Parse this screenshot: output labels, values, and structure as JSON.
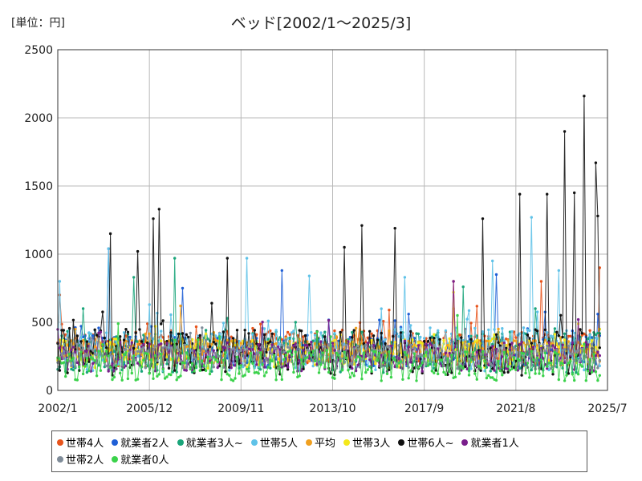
{
  "unit_label": "[単位：円]",
  "chart_data": {
    "type": "line",
    "title": "ベッド[2002/1～2025/3]",
    "xlabel": "",
    "ylabel": "",
    "ylim": [
      0,
      2500
    ],
    "yticks": [
      "0",
      "500",
      "1000",
      "1500",
      "2000",
      "2500"
    ],
    "xlim": [
      "2002/1",
      "2025/7"
    ],
    "xticks": [
      "2002/1",
      "2005/12",
      "2009/11",
      "2013/10",
      "2017/9",
      "2021/8",
      "2025/7"
    ],
    "grid": true,
    "legend_position": "bottom",
    "series": [
      {
        "name": "世帯4人",
        "color": "#e8541c",
        "baseline": 310,
        "amp": 130,
        "peaks": [
          [
            "2002/2",
            700
          ],
          [
            "2016/3",
            590
          ],
          [
            "2018/12",
            800
          ],
          [
            "2022/9",
            800
          ],
          [
            "2025/3",
            900
          ]
        ]
      },
      {
        "name": "就業者2人",
        "color": "#1f5fd6",
        "baseline": 290,
        "amp": 120,
        "peaks": [
          [
            "2004/3",
            1040
          ],
          [
            "2007/5",
            750
          ],
          [
            "2011/8",
            880
          ],
          [
            "2017/1",
            560
          ],
          [
            "2020/10",
            850
          ],
          [
            "2025/2",
            560
          ]
        ]
      },
      {
        "name": "就業者3人~",
        "color": "#1aa57a",
        "baseline": 280,
        "amp": 150,
        "peaks": [
          [
            "2003/2",
            600
          ],
          [
            "2005/4",
            830
          ],
          [
            "2007/1",
            970
          ],
          [
            "2012/3",
            500
          ],
          [
            "2019/5",
            760
          ],
          [
            "2022/6",
            600
          ]
        ]
      },
      {
        "name": "世帯5人",
        "color": "#5fc2e8",
        "baseline": 300,
        "amp": 160,
        "peaks": [
          [
            "2002/2",
            800
          ],
          [
            "2004/3",
            1040
          ],
          [
            "2010/2",
            970
          ],
          [
            "2012/10",
            840
          ],
          [
            "2016/11",
            830
          ],
          [
            "2020/8",
            950
          ],
          [
            "2022/4",
            1270
          ],
          [
            "2023/6",
            880
          ]
        ]
      },
      {
        "name": "平均",
        "color": "#f0a020",
        "baseline": 290,
        "amp": 80,
        "peaks": [
          [
            "2007/4",
            620
          ],
          [
            "2018/12",
            600
          ]
        ]
      },
      {
        "name": "世帯3人",
        "color": "#f4e81a",
        "baseline": 270,
        "amp": 110,
        "peaks": [
          [
            "2006/3",
            470
          ],
          [
            "2018/12",
            720
          ]
        ]
      },
      {
        "name": "世帯6人~",
        "color": "#111111",
        "baseline": 280,
        "amp": 170,
        "peaks": [
          [
            "2004/4",
            1150
          ],
          [
            "2005/6",
            1020
          ],
          [
            "2006/2",
            1260
          ],
          [
            "2006/5",
            1330
          ],
          [
            "2009/4",
            970
          ],
          [
            "2014/4",
            1050
          ],
          [
            "2015/1",
            1210
          ],
          [
            "2016/6",
            1190
          ],
          [
            "2020/3",
            1260
          ],
          [
            "2021/10",
            1440
          ],
          [
            "2022/12",
            1440
          ],
          [
            "2023/9",
            1900
          ],
          [
            "2024/2",
            1450
          ],
          [
            "2024/7",
            2160
          ],
          [
            "2025/1",
            1670
          ],
          [
            "2025/2",
            1280
          ]
        ]
      },
      {
        "name": "就業者1人",
        "color": "#7a1f8c",
        "baseline": 250,
        "amp": 110,
        "peaks": [
          [
            "2018/12",
            800
          ],
          [
            "2024/4",
            520
          ]
        ]
      },
      {
        "name": "世帯2人",
        "color": "#7f8c99",
        "baseline": 250,
        "amp": 90,
        "peaks": [
          [
            "2008/3",
            460
          ],
          [
            "2019/6",
            450
          ]
        ]
      },
      {
        "name": "就業者0人",
        "color": "#3ad24a",
        "baseline": 180,
        "amp": 110,
        "peaks": [
          [
            "2004/8",
            490
          ],
          [
            "2013/2",
            430
          ],
          [
            "2019/2",
            550
          ]
        ]
      }
    ]
  }
}
